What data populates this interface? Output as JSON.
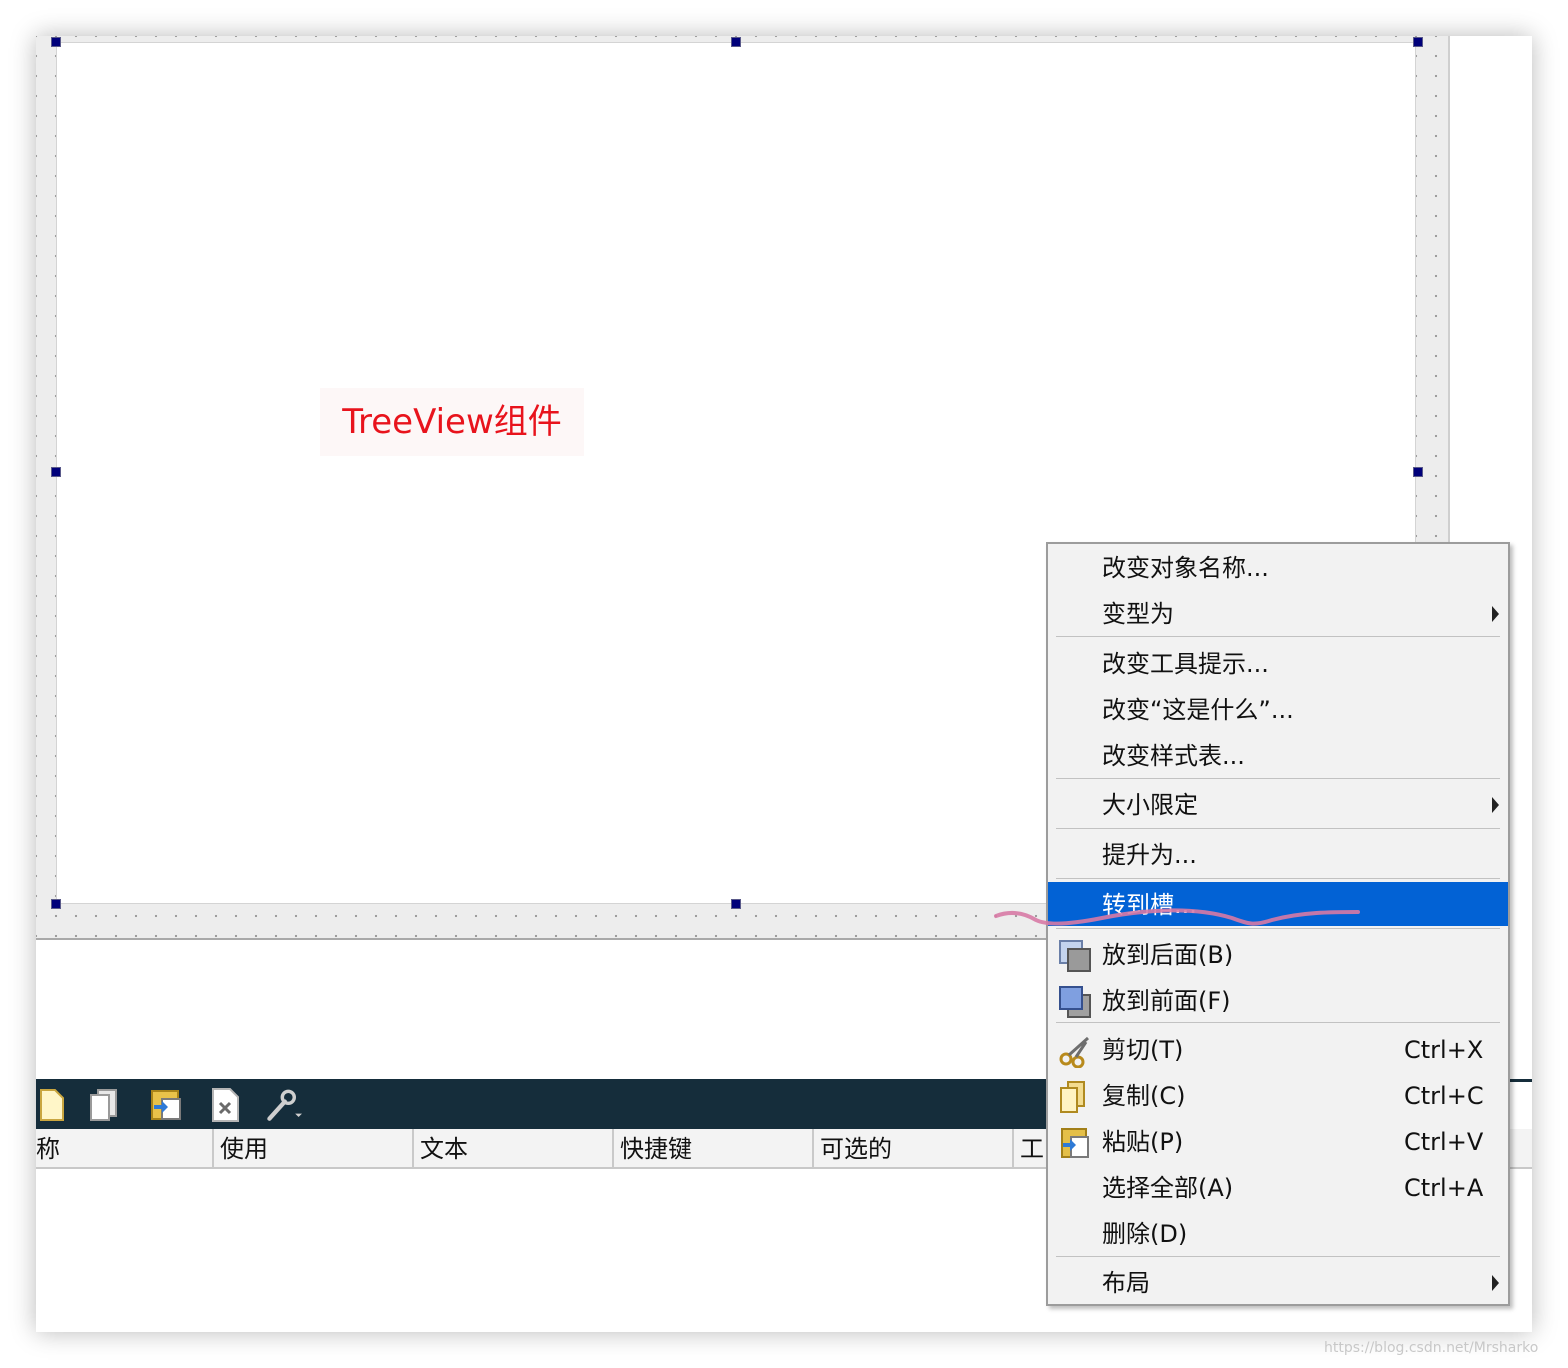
{
  "designer": {
    "widget_label": "TreeView组件"
  },
  "action_editor": {
    "toolbar_icons": [
      "new-action-icon",
      "copy-action-icon",
      "paste-action-icon",
      "delete-action-icon",
      "configure-wrench-icon"
    ],
    "columns": [
      "名称",
      "使用",
      "文本",
      "快捷键",
      "可选的",
      "工具提示"
    ],
    "first_column_visible": "称",
    "last_column_visible": "工"
  },
  "context_menu": {
    "items": [
      {
        "label": "改变对象名称...",
        "has_submenu": false
      },
      {
        "label": "变型为",
        "has_submenu": true
      },
      {
        "label": "改变工具提示...",
        "has_submenu": false
      },
      {
        "label": "改变“这是什么”...",
        "has_submenu": false
      },
      {
        "label": "改变样式表...",
        "has_submenu": false
      },
      {
        "label": "大小限定",
        "has_submenu": true
      },
      {
        "label": "提升为...",
        "has_submenu": false
      },
      {
        "label": "转到槽...",
        "highlighted": true
      },
      {
        "label": "放到后面(B)",
        "icon": "send-to-back-icon"
      },
      {
        "label": "放到前面(F)",
        "icon": "bring-to-front-icon"
      },
      {
        "label": "剪切(T)",
        "shortcut": "Ctrl+X",
        "icon": "cut-scissors-icon"
      },
      {
        "label": "复制(C)",
        "shortcut": "Ctrl+C",
        "icon": "copy-icon"
      },
      {
        "label": "粘贴(P)",
        "shortcut": "Ctrl+V",
        "icon": "paste-icon"
      },
      {
        "label": "选择全部(A)",
        "shortcut": "Ctrl+A"
      },
      {
        "label": "删除(D)"
      },
      {
        "label": "布局",
        "has_submenu": true
      }
    ]
  },
  "colors": {
    "highlight": "#0262d5",
    "caption_text": "#e8131c",
    "dock_toolbar": "#152d3b",
    "handle": "#00007a"
  },
  "watermark": "https://blog.csdn.net/Mrsharko"
}
